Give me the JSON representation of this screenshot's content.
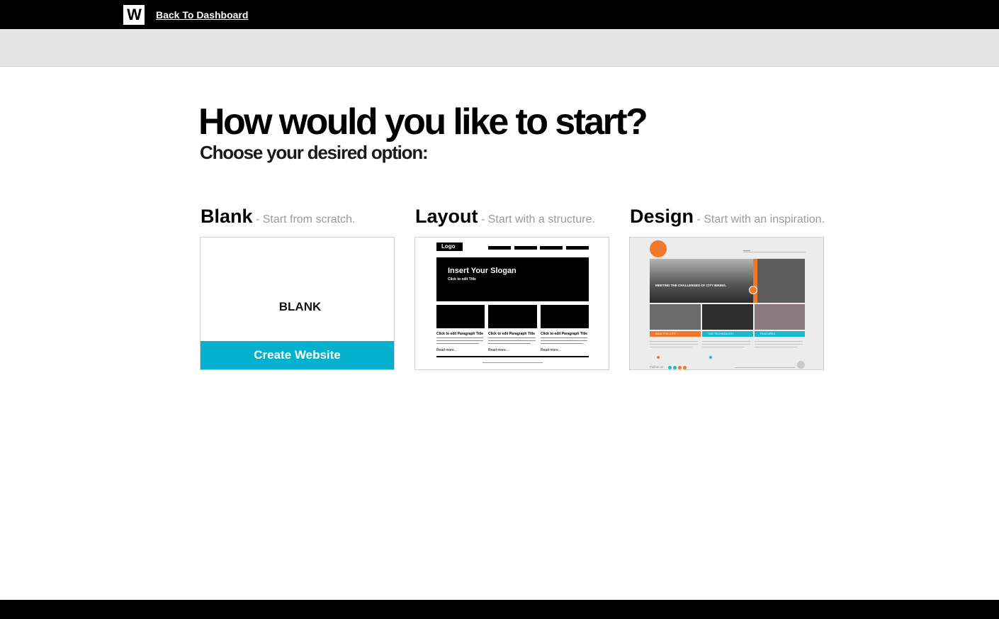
{
  "topbar": {
    "logo_letter": "W",
    "back_link": "Back To Dashboard"
  },
  "main": {
    "headline": "How would you like to start?",
    "subheadline": "Choose your desired option:"
  },
  "options": [
    {
      "name": "Blank",
      "description": "- Start from scratch.",
      "card_label": "BLANK",
      "button": "Create Website"
    },
    {
      "name": "Layout",
      "description": "- Start with a structure.",
      "thumbnail": {
        "logo": "Logo",
        "slogan": "Insert Your Slogan",
        "slogan_sub": "Click to edit Title",
        "paragraph_title": "Click to edit Paragraph Title",
        "read_more": "Read more..."
      }
    },
    {
      "name": "Design",
      "description": "- Start with an inspiration.",
      "thumbnail": {
        "banner_text": "MEETING THE CHALLENGES OF CITY BIKING.",
        "col1": "RIDE THE CITY",
        "col2": "THE TECHNOLOGY",
        "col3": "FEATURES",
        "follow": "Follow us:"
      }
    }
  ],
  "colors": {
    "accent": "#03b1cf",
    "topbar": "#000000",
    "subbar": "#e5e5e5",
    "design_orange": "#f0782b",
    "design_teal": "#1ab9cf"
  }
}
